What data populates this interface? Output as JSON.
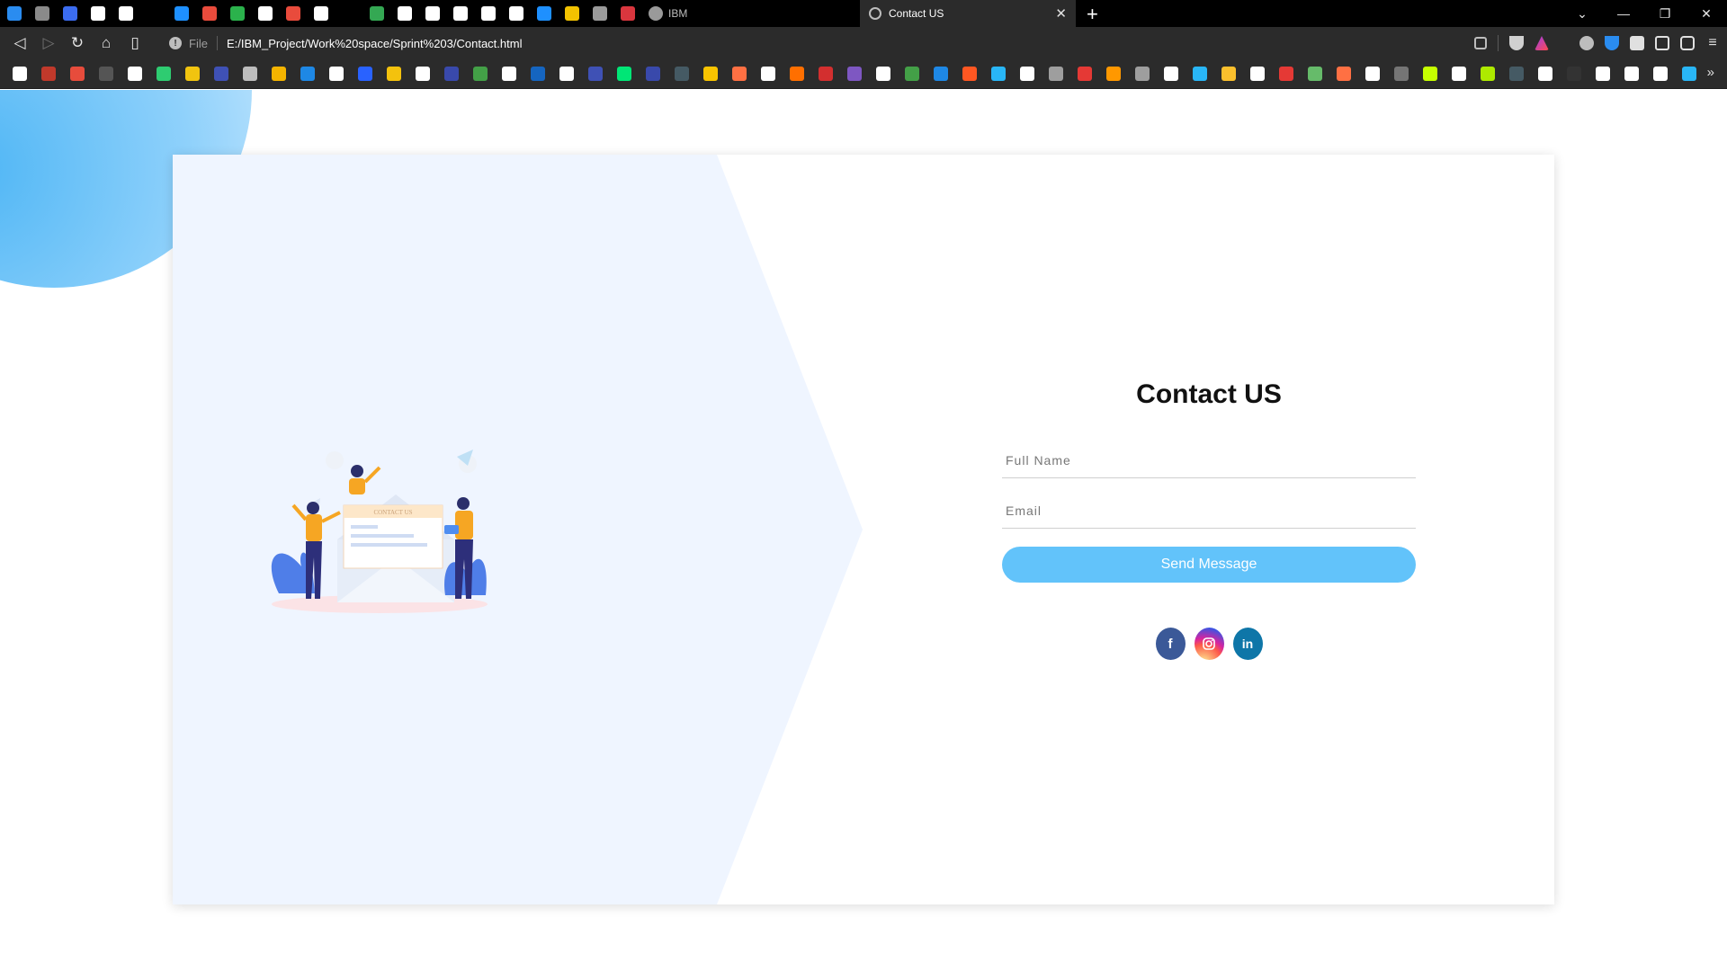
{
  "browser": {
    "pinned_tab_count": 23,
    "pinned_tab_colors": [
      "#2a8cf0",
      "#8a8a8a",
      "#3b6cf0",
      "#ffffff",
      "#ffffff",
      "#000000",
      "#1e90ff",
      "#e94b3c",
      "#2bb24c",
      "#ffffff",
      "#e94b3c",
      "#ffffff",
      "#000000",
      "#34a853",
      "#ffffff",
      "#ffffff",
      "#ffffff",
      "#ffffff",
      "#ffffff",
      "#1e90ff",
      "#f2c200",
      "#9a9a9a",
      "#d9363e"
    ],
    "inactive_tab_title": "IBM",
    "active_tab_title": "Contact US",
    "new_tab_icon": "plus-icon",
    "window_controls": [
      "chevron-down-icon",
      "minimize-icon",
      "restore-icon",
      "close-icon"
    ],
    "address": {
      "scheme_label": "File",
      "url": "E:/IBM_Project/Work%20space/Sprint%203/Contact.html"
    },
    "nav_icons": [
      "back-icon",
      "forward-icon",
      "reload-icon",
      "home-icon",
      "bookmark-icon"
    ],
    "toolbar_icons": [
      "share-icon",
      "brave-shield-icon",
      "brave-rewards-icon",
      "bulb-extension-icon",
      "shield-extension-icon",
      "puzzle-extensions-icon",
      "sidebar-icon",
      "wallet-icon",
      "menu-icon"
    ],
    "bookmark_colors": [
      "#ffffff",
      "#c0392b",
      "#e74c3c",
      "#555555",
      "#ffffff",
      "#2ecc71",
      "#f1c40f",
      "#3f51b5",
      "#bdbdbd",
      "#f4b400",
      "#1e88e5",
      "#ffffff",
      "#2962ff",
      "#f4c20d",
      "#ffffff",
      "#3949ab",
      "#43a047",
      "#ffffff",
      "#1565c0",
      "#ffffff",
      "#3f51b5",
      "#00e676",
      "#3949ab",
      "#455a64",
      "#f9c400",
      "#ff7043",
      "#ffffff",
      "#ff6f00",
      "#d32f2f",
      "#7e57c2",
      "#ffffff",
      "#43a047",
      "#1e88e5",
      "#ff5722",
      "#29b6f6",
      "#ffffff",
      "#9e9e9e",
      "#e53935",
      "#ff9800",
      "#9e9e9e",
      "#ffffff",
      "#29b6f6",
      "#fbc02d",
      "#ffffff",
      "#e53935",
      "#66bb6a",
      "#ff7043",
      "#ffffff",
      "#757575",
      "#c6ff00",
      "#ffffff",
      "#aeea00",
      "#455a64",
      "#ffffff",
      "#333333",
      "#ffffff",
      "#ffffff",
      "#ffffff",
      "#29b6f6"
    ],
    "more_bookmarks_icon": "double-chevron-right-icon"
  },
  "page": {
    "illustration": "contact-us-illustration",
    "illustration_banner_text": "CONTACT US",
    "title": "Contact US",
    "full_name_placeholder": "Full Name",
    "email_placeholder": "Email",
    "send_label": "Send Message",
    "social": {
      "facebook_glyph": "f",
      "linkedin_glyph": "in"
    },
    "accent_color": "#62c3fa",
    "panel_color": "#eff5ff"
  }
}
